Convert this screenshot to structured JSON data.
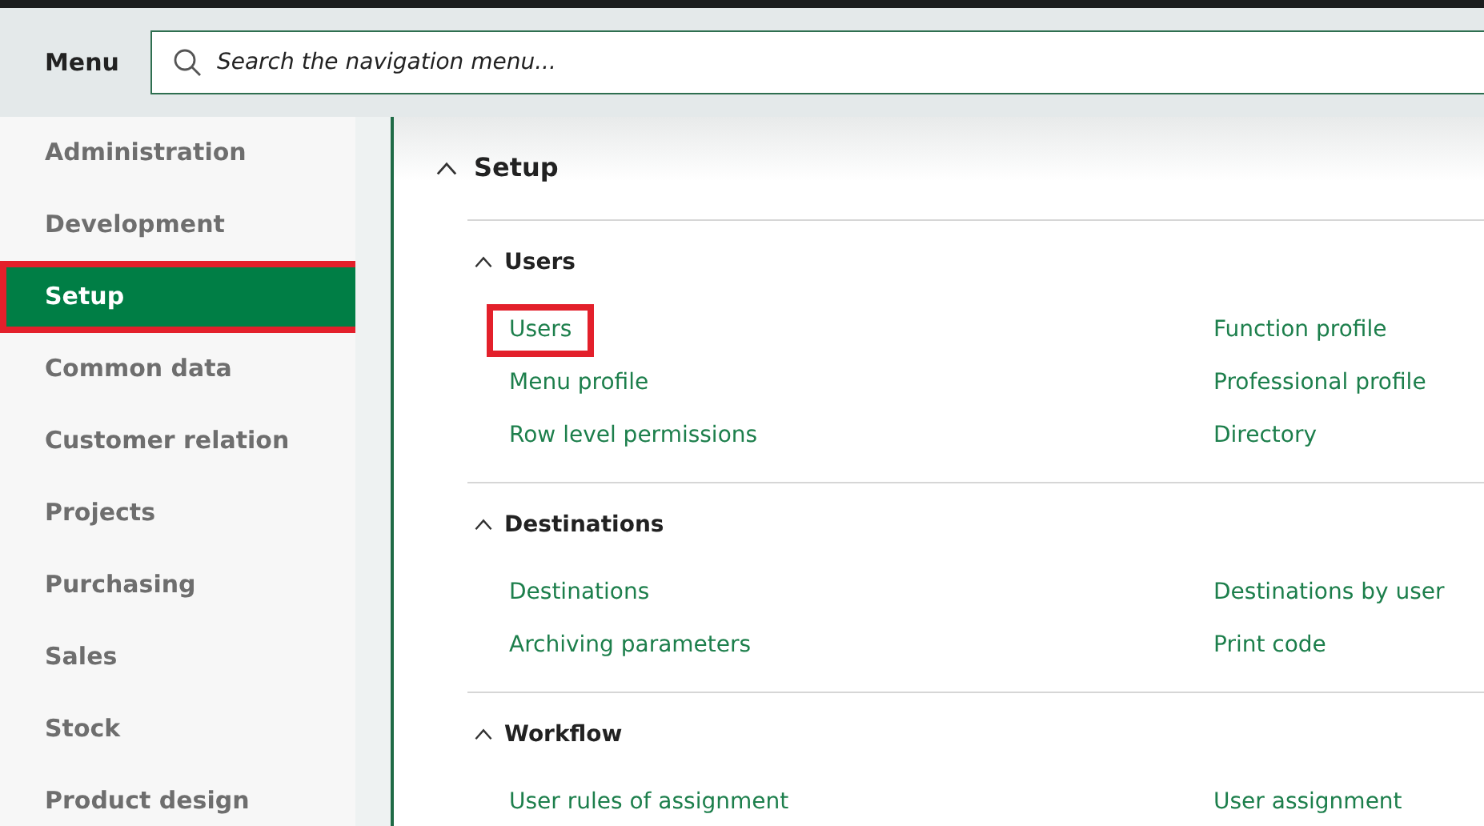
{
  "header": {
    "title": "Menu",
    "search": {
      "placeholder": "Search the navigation menu..."
    }
  },
  "sidebar": {
    "items": [
      {
        "label": "Administration",
        "selected": false,
        "highlighted": false
      },
      {
        "label": "Development",
        "selected": false,
        "highlighted": false
      },
      {
        "label": "Setup",
        "selected": true,
        "highlighted": true
      },
      {
        "label": "Common data",
        "selected": false,
        "highlighted": false
      },
      {
        "label": "Customer relation",
        "selected": false,
        "highlighted": false
      },
      {
        "label": "Projects",
        "selected": false,
        "highlighted": false
      },
      {
        "label": "Purchasing",
        "selected": false,
        "highlighted": false
      },
      {
        "label": "Sales",
        "selected": false,
        "highlighted": false
      },
      {
        "label": "Stock",
        "selected": false,
        "highlighted": false
      },
      {
        "label": "Product design",
        "selected": false,
        "highlighted": false
      }
    ]
  },
  "main": {
    "title": "Setup",
    "expanded": true,
    "sections": [
      {
        "title": "Users",
        "expanded": true,
        "links": [
          {
            "label": "Users",
            "highlighted": true
          },
          {
            "label": "Function profile",
            "highlighted": false
          },
          {
            "label": "Menu profile",
            "highlighted": false
          },
          {
            "label": "Professional profile",
            "highlighted": false
          },
          {
            "label": "Row level permissions",
            "highlighted": false
          },
          {
            "label": "Directory",
            "highlighted": false
          }
        ]
      },
      {
        "title": "Destinations",
        "expanded": true,
        "links": [
          {
            "label": "Destinations",
            "highlighted": false
          },
          {
            "label": "Destinations by user",
            "highlighted": false
          },
          {
            "label": "Archiving parameters",
            "highlighted": false
          },
          {
            "label": "Print code",
            "highlighted": false
          }
        ]
      },
      {
        "title": "Workflow",
        "expanded": true,
        "links": [
          {
            "label": "User rules of assignment",
            "highlighted": false
          },
          {
            "label": "User assignment",
            "highlighted": false
          }
        ]
      }
    ]
  }
}
